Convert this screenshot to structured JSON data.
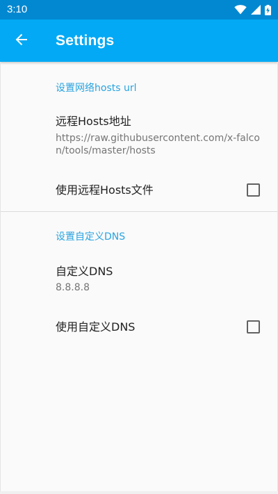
{
  "status_bar": {
    "time": "3:10",
    "icons": [
      "wifi-icon",
      "signal-icon",
      "battery-icon"
    ]
  },
  "app_bar": {
    "title": "Settings",
    "back_icon": "arrow-back-icon"
  },
  "categories": [
    {
      "title": "设置网络hosts url",
      "preferences": [
        {
          "title": "远程Hosts地址",
          "summary": "https://raw.githubusercontent.com/x-falcon/tools/master/hosts"
        },
        {
          "title": "使用远程Hosts文件",
          "checked": false
        }
      ]
    },
    {
      "title": "设置自定义DNS",
      "preferences": [
        {
          "title": "自定义DNS",
          "summary": "8.8.8.8"
        },
        {
          "title": "使用自定义DNS",
          "checked": false
        }
      ]
    }
  ],
  "colors": {
    "status_bar": "#0288d1",
    "app_bar": "#03a9f4",
    "accent": "#29a3e0",
    "background": "#fafafa"
  }
}
